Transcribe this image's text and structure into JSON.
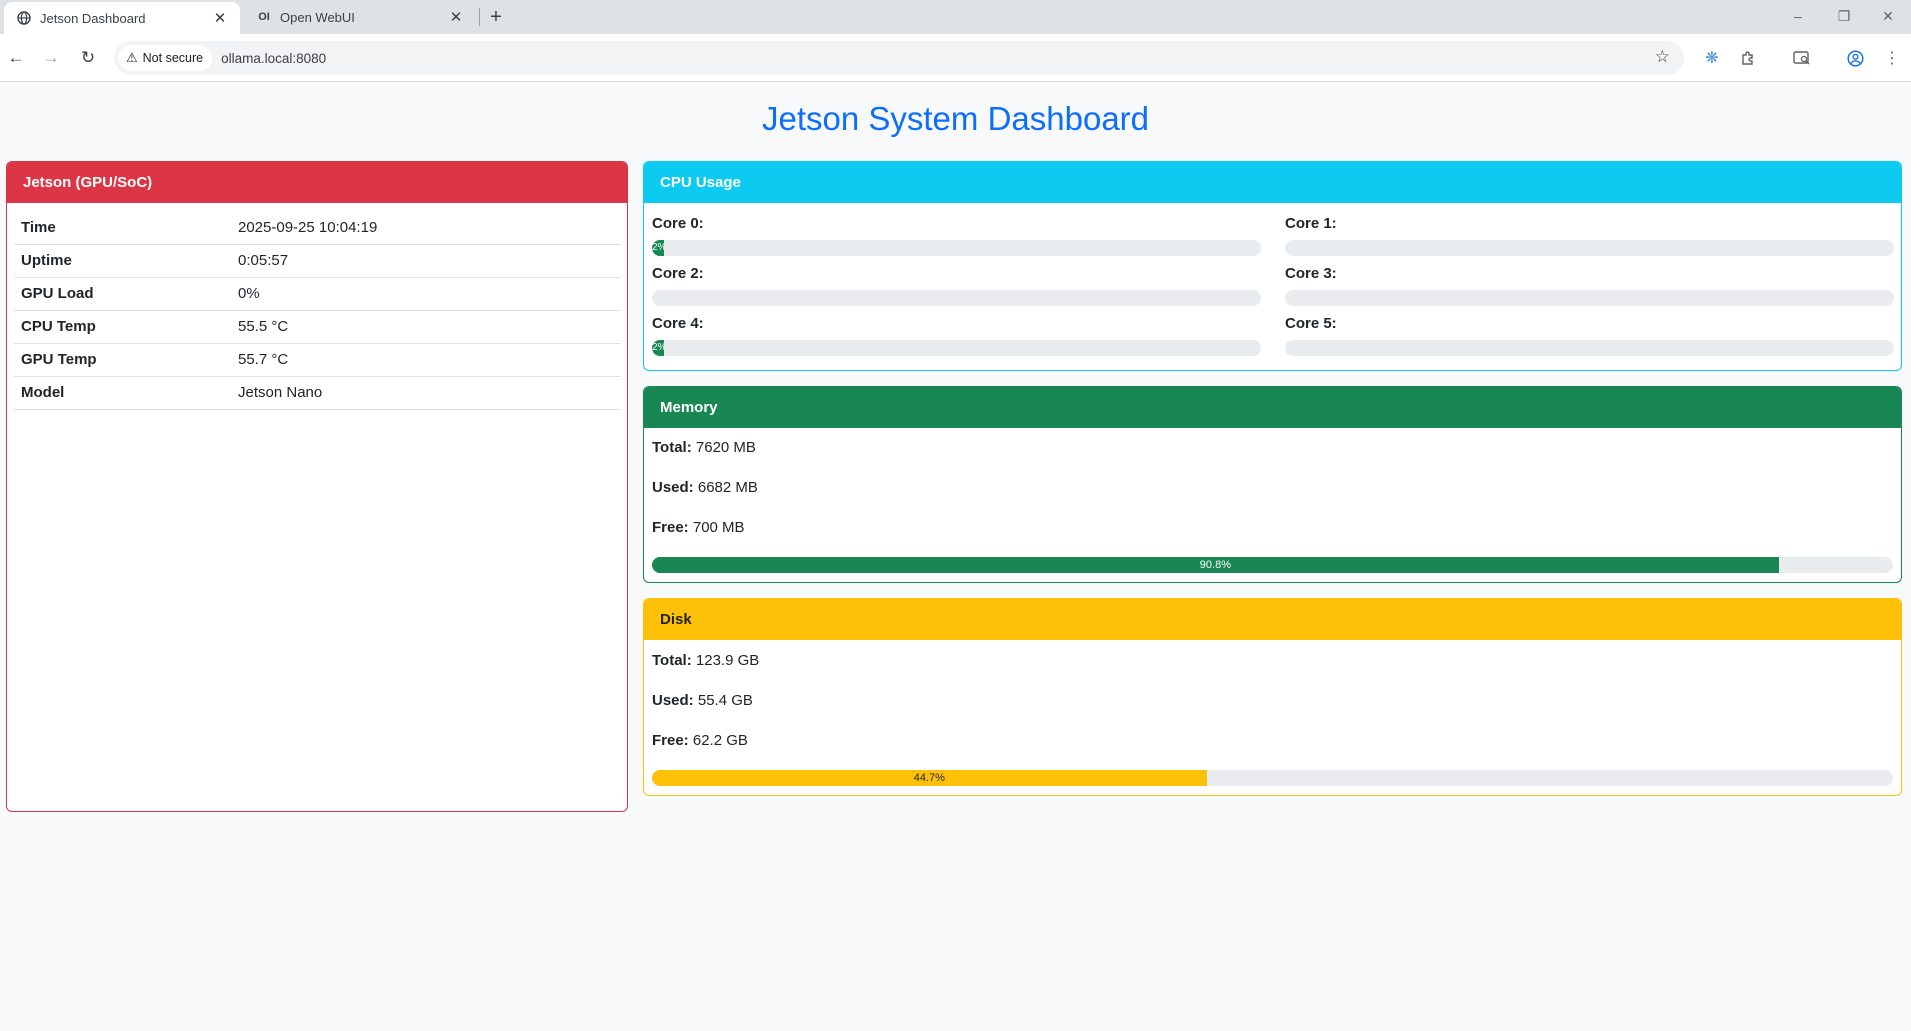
{
  "browser": {
    "tabs": [
      {
        "label": "Jetson Dashboard",
        "favicon": "globe-icon"
      },
      {
        "label": "Open WebUI",
        "favicon": "OI"
      }
    ],
    "security_label": "Not secure",
    "url": "ollama.local:8080"
  },
  "page": {
    "title": "Jetson System Dashboard"
  },
  "jetson": {
    "header": "Jetson (GPU/SoC)",
    "rows": [
      {
        "key": "Time",
        "value": "2025-09-25 10:04:19"
      },
      {
        "key": "Uptime",
        "value": "0:05:57"
      },
      {
        "key": "GPU Load",
        "value": "0%"
      },
      {
        "key": "CPU Temp",
        "value": "55.5 °C"
      },
      {
        "key": "GPU Temp",
        "value": "55.7 °C"
      },
      {
        "key": "Model",
        "value": "Jetson Nano"
      }
    ]
  },
  "cpu": {
    "header": "CPU Usage",
    "cores": [
      {
        "label": "Core 0:",
        "percent": 2,
        "text": "2%"
      },
      {
        "label": "Core 1:",
        "percent": 0,
        "text": ""
      },
      {
        "label": "Core 2:",
        "percent": 0,
        "text": ""
      },
      {
        "label": "Core 3:",
        "percent": 0,
        "text": ""
      },
      {
        "label": "Core 4:",
        "percent": 2,
        "text": "2%"
      },
      {
        "label": "Core 5:",
        "percent": 0,
        "text": ""
      }
    ]
  },
  "memory": {
    "header": "Memory",
    "total_label": "Total:",
    "total": "7620 MB",
    "used_label": "Used:",
    "used": "6682 MB",
    "free_label": "Free:",
    "free": "700 MB",
    "percent": 90.8,
    "percent_text": "90.8%"
  },
  "disk": {
    "header": "Disk",
    "total_label": "Total:",
    "total": "123.9 GB",
    "used_label": "Used:",
    "used": "55.4 GB",
    "free_label": "Free:",
    "free": "62.2 GB",
    "percent": 44.7,
    "percent_text": "44.7%"
  },
  "colors": {
    "title": "#0d6efd",
    "jetson": "#dc3545",
    "cpu": "#0dcaf0",
    "memory": "#198754",
    "disk": "#ffc107"
  }
}
